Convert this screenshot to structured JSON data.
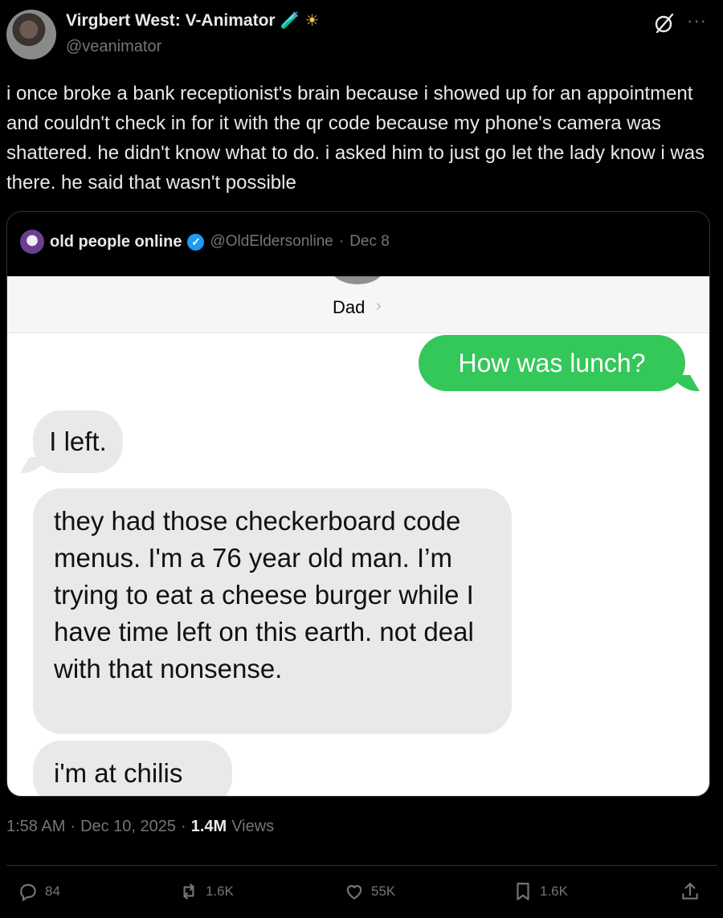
{
  "author": {
    "display_name": "Virgbert West: V-Animator",
    "emoji_1": "🧪",
    "emoji_2": "☀",
    "handle": "@veanimator"
  },
  "tweet": {
    "text": "i once broke a bank receptionist's brain because i showed up for an appointment and couldn't check in for it with the qr code because my phone's camera was shattered. he didn't know what to do. i asked him to just go let the lady know i was there. he said that wasn't possible"
  },
  "quoted": {
    "name": "old people online",
    "handle": "@OldEldersonline",
    "separator": "·",
    "date": "Dec 8",
    "screenshot": {
      "contact": "Dad",
      "contact_chevron": "›",
      "messages": [
        {
          "from": "me",
          "text": "How was lunch?"
        },
        {
          "from": "them",
          "text": "I left."
        },
        {
          "from": "them",
          "text": "they had those checkerboard code menus. I'm a 76 year old man. I’m trying to eat a cheese burger while I have time left on this earth. not deal with that nonsense."
        },
        {
          "from": "them",
          "text": "i'm at chilis"
        }
      ]
    }
  },
  "meta": {
    "time": "1:58 AM",
    "separator": "·",
    "date": "Dec 10, 2025",
    "views_count": "1.4M",
    "views_label": "Views"
  },
  "actions": {
    "replies": "84",
    "reposts": "1.6K",
    "likes": "55K",
    "bookmarks": "1.6K"
  },
  "icons": {
    "grok": "grok-icon",
    "more": "more-icon",
    "verified": "verified-badge-icon",
    "reply": "reply-icon",
    "repost": "repost-icon",
    "like": "heart-icon",
    "bookmark": "bookmark-icon",
    "share": "share-icon"
  },
  "colors": {
    "background": "#000000",
    "text": "#e7e9ea",
    "muted": "#71767b",
    "verified": "#1d9bf0",
    "imessage_sent": "#34c759",
    "imessage_received": "#e9e9eb"
  }
}
